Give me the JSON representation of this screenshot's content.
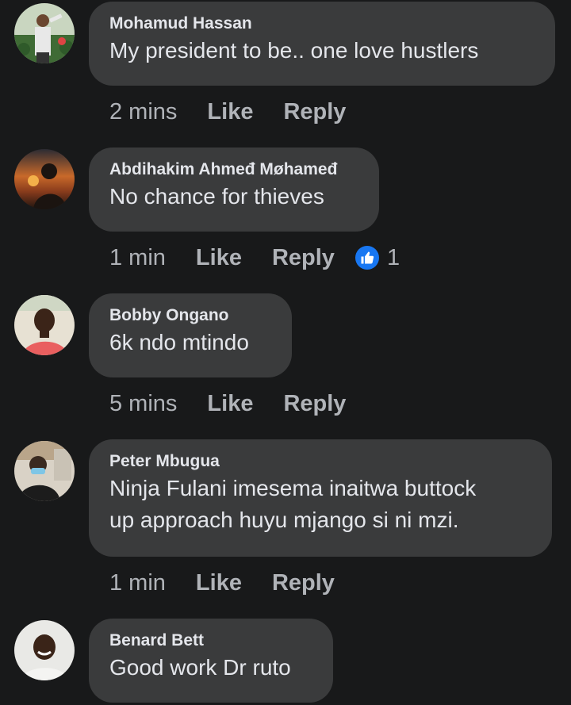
{
  "colors": {
    "background": "#18191a",
    "bubble": "#3a3b3c",
    "text": "#e4e6eb",
    "secondary_text": "#b0b3b8",
    "like_blue": "#1877f2"
  },
  "comments": [
    {
      "author": "Mohamud Hassan",
      "text_lines": [
        "My president to be..  one love hustlers"
      ],
      "time": "2 mins",
      "like_label": "Like",
      "reply_label": "Reply",
      "avatar_icon": "avatar-photo"
    },
    {
      "author": "Abdihakim Ahmeđ Møhameđ",
      "text_lines": [
        "No chance for thieves"
      ],
      "time": "1 min",
      "like_label": "Like",
      "reply_label": "Reply",
      "reaction_icon": "thumbs-up-icon",
      "reaction_count": "1",
      "avatar_icon": "avatar-photo"
    },
    {
      "author": "Bobby Ongano",
      "text_lines": [
        "6k ndo mtindo"
      ],
      "time": "5 mins",
      "like_label": "Like",
      "reply_label": "Reply",
      "avatar_icon": "avatar-photo"
    },
    {
      "author": "Peter Mbugua",
      "text_lines": [
        "Ninja Fulani imesema inaitwa buttock",
        "up approach huyu mjango si ni mzi."
      ],
      "time": "1 min",
      "like_label": "Like",
      "reply_label": "Reply",
      "avatar_icon": "avatar-photo"
    },
    {
      "author": "Benard Bett",
      "text_lines": [
        "Good work Dr ruto"
      ],
      "avatar_icon": "avatar-photo"
    }
  ]
}
